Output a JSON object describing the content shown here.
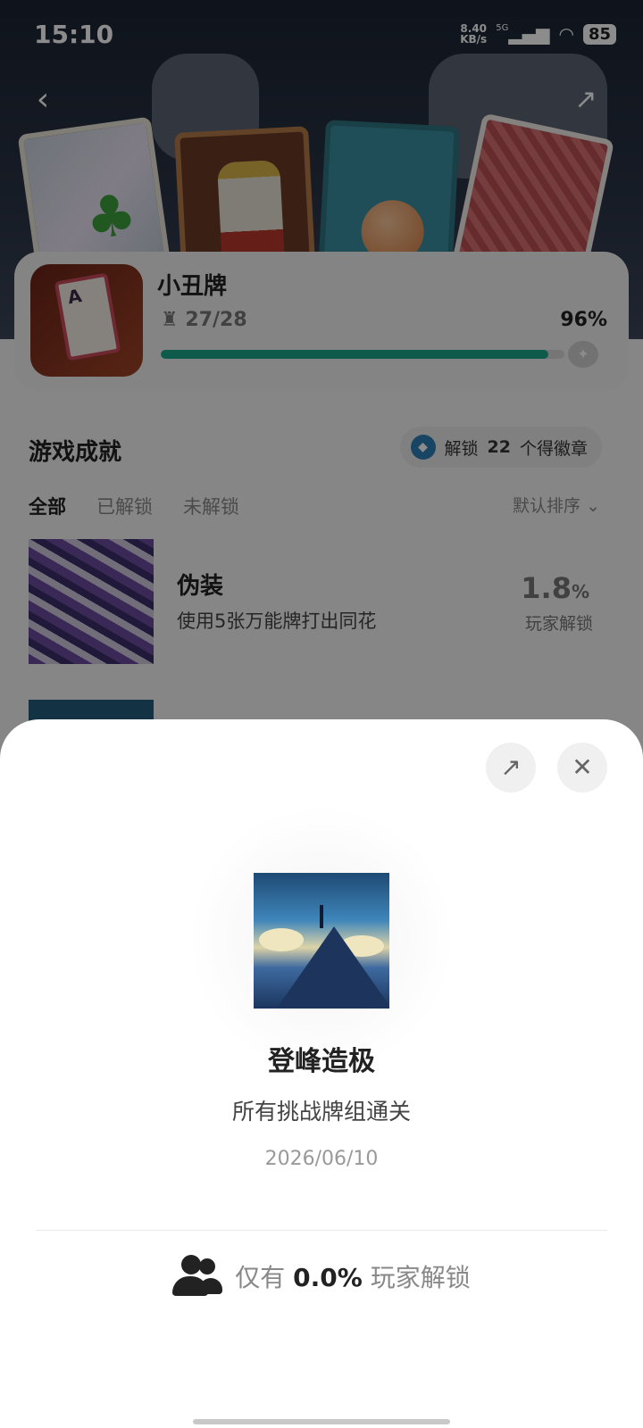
{
  "status_bar": {
    "time": "15:10",
    "net_speed_value": "8.40",
    "net_speed_unit": "KB/s",
    "network": "5G",
    "battery": "85"
  },
  "header": {
    "back_icon": "chevron-left-icon",
    "share_icon": "share-icon"
  },
  "game": {
    "title": "小丑牌",
    "trophy_count": "27/28",
    "percent_text": "96%",
    "progress": 0.96
  },
  "achievements": {
    "section_title": "游戏成就",
    "badge_prefix": "解锁",
    "badge_count": "22",
    "badge_suffix": "个得徽章",
    "tabs": [
      "全部",
      "已解锁",
      "未解锁"
    ],
    "sort_label": "默认排序",
    "items": [
      {
        "title": "伪装",
        "desc": "使用5张万能牌打出同花",
        "percent_value": "1.8",
        "percent_unit": "%",
        "sub": "玩家解锁"
      }
    ]
  },
  "sheet": {
    "title": "登峰造极",
    "desc": "所有挑战牌组通关",
    "date": "2026/06/10",
    "stat_prefix": "仅有",
    "stat_value": "0.0%",
    "stat_suffix": "玩家解锁"
  },
  "colors": {
    "accent": "#1aa68a",
    "badge_blue": "#2f7fb8"
  }
}
